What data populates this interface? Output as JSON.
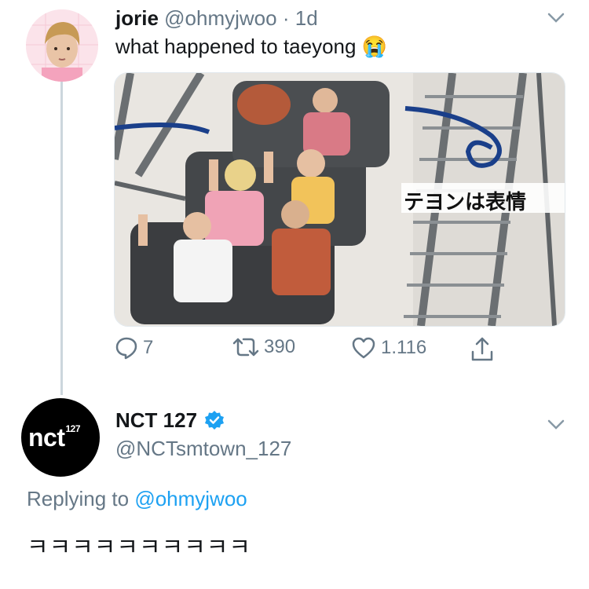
{
  "tweet1": {
    "name": "jorie",
    "handle": "@ohmyjwoo",
    "separator": "·",
    "time": "1d",
    "text": "what happened to taeyong",
    "emoji": "😭",
    "media": {
      "caption": "テヨンは表情"
    },
    "actions": {
      "reply_count": "7",
      "retweet_count": "390",
      "like_count": "1.116"
    }
  },
  "tweet2": {
    "avatar_logo": "nct",
    "avatar_logo_sup": "127",
    "name": "NCT 127",
    "handle": "@NCTsmtown_127",
    "replying_prefix": "Replying to",
    "replying_handle": "@ohmyjwoo",
    "text": "ㅋㅋㅋㅋㅋㅋㅋㅋㅋㅋ"
  },
  "colors": {
    "muted": "#657786",
    "link": "#1da1f2",
    "verified": "#1da1f2",
    "thread_line": "#ccd6dd"
  },
  "icons": [
    "chevron-down-icon",
    "reply-icon",
    "retweet-icon",
    "like-icon",
    "share-icon",
    "verified-icon"
  ]
}
